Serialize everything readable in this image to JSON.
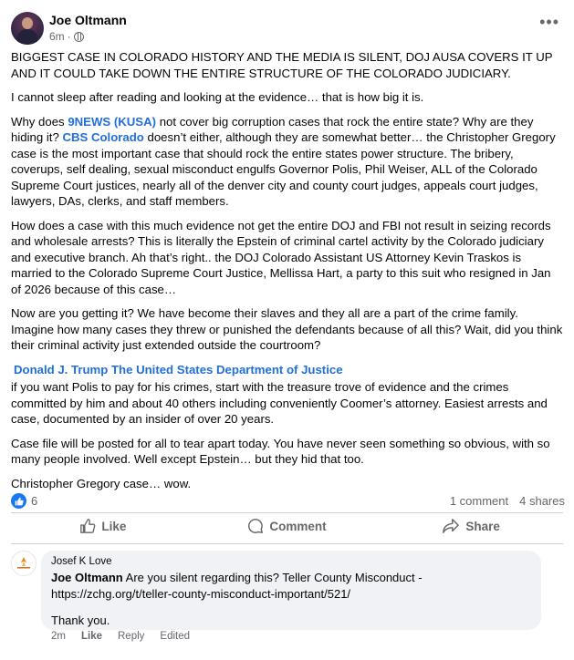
{
  "post": {
    "author": "Joe Oltmann",
    "time": "6m",
    "separator": "·",
    "paragraphs": {
      "p1": "BIGGEST CASE IN COLORADO HISTORY AND THE MEDIA IS SILENT, DOJ AUSA COVERS IT UP AND IT COULD TAKE DOWN THE ENTIRE STRUCTURE OF THE COLORADO JUDICIARY.",
      "p2": "I cannot sleep after reading and looking at the evidence… that is how big it is.",
      "p3_a": "Why does ",
      "p3_link1": "9NEWS (KUSA)",
      "p3_b": " not cover big corruption cases that rock the entire state? Why are they hiding it? ",
      "p3_link2": "CBS Colorado",
      "p3_c": " doesn’t either, although they are somewhat better… the Christopher Gregory case is the most important case that should rock the entire states power structure. The bribery, coverups, self dealing, sexual misconduct engulfs Governor Polis, Phil Weiser, ALL of the Colorado Supreme Court justices, nearly all of the denver city and county court judges, appeals court judges, lawyers, DAs, clerks, and staff members.",
      "p4": "How does a case with this much evidence not get the entire DOJ and FBI not result in seizing records and wholesale arrests? This is literally the Epstein of criminal cartel activity by the Colorado judiciary and executive branch. Ah that’s right.. the DOJ Colorado Assistant US Attorney Kevin Traskos is married to the Colorado Supreme Court Justice, Mellissa Hart, a party to this suit who resigned in Jan of 2026 because of this case…",
      "p5": "Now are you getting it? We have become their slaves and they all are a part of the crime family. Imagine how many cases they threw or punished the defendants because of all this? Wait, did you think their criminal activity just extended outside the courtroom?",
      "p6_link1": "Donald J. Trump",
      "p6_link2": "The United States Department of Justice",
      "p6_text": " if you want Polis to pay for his crimes, start with the treasure trove of evidence and the crimes committed by him and about 40 others including conveniently Coomer’s attorney. Easiest arrests and case, documented by an insider of over 20 years.",
      "p7": "Case file will be posted for all to tear apart today. You have never seen something so obvious, with so many people involved. Well except Epstein… but they hid that too.",
      "p8": "Christopher Gregory case… wow."
    },
    "stats": {
      "likes": "6",
      "comments": "1 comment",
      "shares": "4 shares"
    },
    "actions": {
      "like": "Like",
      "comment": "Comment",
      "share": "Share"
    }
  },
  "comment": {
    "author": "Josef K Love",
    "tag": "Joe Oltmann",
    "text": " Are you silent regarding this? Teller County Misconduct - https://zchg.org/t/teller-county-misconduct-important/521/",
    "thanks": "Thank you.",
    "time": "2m",
    "like": "Like",
    "reply": "Reply",
    "edited": "Edited"
  },
  "colors": {
    "link": "#216fdb",
    "like_badge": "#1877f2",
    "muted": "#65676b",
    "bubble": "#f0f2f5"
  },
  "icons": [
    "globe-icon",
    "more-icon",
    "like-badge-icon",
    "like-icon",
    "comment-icon",
    "share-icon",
    "avatar-logo"
  ]
}
